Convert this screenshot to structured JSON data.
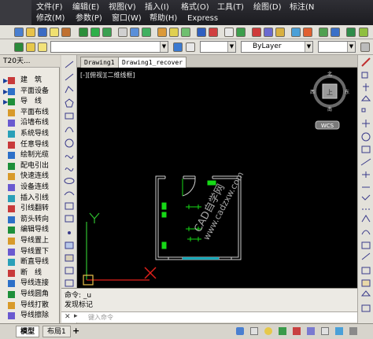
{
  "menubar": {
    "row1": [
      "文件(F)",
      "编辑(E)",
      "视图(V)",
      "插入(I)",
      "格式(O)",
      "工具(T)",
      "绘图(D)",
      "标注(N"
    ],
    "row2": [
      "修改(M)",
      "参数(P)",
      "窗口(W)",
      "帮助(H)",
      "Express"
    ]
  },
  "toolbar2": {
    "layer_combo": "ByLayer"
  },
  "left_panel": {
    "title": "T20天...",
    "items": [
      {
        "label": "建　筑",
        "arrow": true,
        "icon": "building-icon"
      },
      {
        "label": "平面设备",
        "arrow": true,
        "icon": "equipment-icon"
      },
      {
        "label": "导　线",
        "arrow": true,
        "icon": "wire-icon"
      },
      {
        "label": "平面布线",
        "arrow": false,
        "icon": "layout-wire-icon"
      },
      {
        "label": "沿墙布线",
        "arrow": false,
        "icon": "wall-wire-icon"
      },
      {
        "label": "系统导线",
        "arrow": false,
        "icon": "system-wire-icon"
      },
      {
        "label": "任意导线",
        "arrow": false,
        "icon": "free-wire-icon"
      },
      {
        "label": "绘制光缆",
        "arrow": false,
        "icon": "fiber-icon"
      },
      {
        "label": "配电引出",
        "arrow": false,
        "icon": "distribution-icon"
      },
      {
        "label": "快速连线",
        "arrow": false,
        "icon": "quick-connect-icon"
      },
      {
        "label": "设备连线",
        "arrow": false,
        "icon": "device-connect-icon"
      },
      {
        "label": "插入引线",
        "arrow": false,
        "icon": "insert-lead-icon"
      },
      {
        "label": "引线翻转",
        "arrow": false,
        "icon": "flip-lead-icon"
      },
      {
        "label": "箭头转向",
        "arrow": false,
        "icon": "arrow-turn-icon"
      },
      {
        "label": "编辑导线",
        "arrow": false,
        "icon": "edit-wire-icon"
      },
      {
        "label": "导线置上",
        "arrow": false,
        "icon": "wire-up-icon"
      },
      {
        "label": "导线置下",
        "arrow": false,
        "icon": "wire-down-icon"
      },
      {
        "label": "断直导线",
        "arrow": false,
        "icon": "break-wire-icon"
      },
      {
        "label": "断　线",
        "arrow": false,
        "icon": "cut-wire-icon"
      },
      {
        "label": "导线连接",
        "arrow": false,
        "icon": "join-wire-icon"
      },
      {
        "label": "导线圆角",
        "arrow": false,
        "icon": "fillet-wire-icon"
      },
      {
        "label": "导线打散",
        "arrow": false,
        "icon": "explode-wire-icon"
      },
      {
        "label": "导线擦除",
        "arrow": false,
        "icon": "erase-wire-icon"
      }
    ]
  },
  "tabs": [
    {
      "label": "Drawing1",
      "active": false
    },
    {
      "label": "Drawing1_recover",
      "active": true
    }
  ],
  "viewport": {
    "label": "[-][俯视][二维线框]",
    "compass": {
      "n": "北",
      "s": "南",
      "e": "东",
      "w": "西",
      "top": "上"
    },
    "wcs": "WCS",
    "watermark": "CAD自学网",
    "watermark_url": "www.cadzxw.com"
  },
  "command": {
    "line1": "命令: _u",
    "line2": "发现标记",
    "placeholder": "键入命令"
  },
  "statusbar": {
    "tabs": [
      {
        "label": "模型",
        "active": true
      },
      {
        "label": "布局1",
        "active": false
      }
    ],
    "add_label": "+"
  },
  "colors": {
    "green": "#16d916",
    "cyan": "#18a8b8",
    "red": "#e0201a",
    "background": "#000000"
  }
}
